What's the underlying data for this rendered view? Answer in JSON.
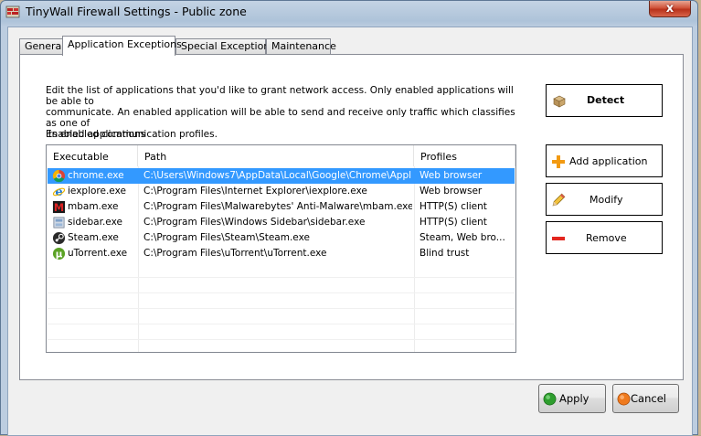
{
  "window": {
    "title": "TinyWall Firewall Settings - Public zone",
    "close_label": "x"
  },
  "tabs": [
    {
      "label": "General"
    },
    {
      "label": "Application Exceptions"
    },
    {
      "label": "Special Exceptions"
    },
    {
      "label": "Maintenance"
    }
  ],
  "panel": {
    "description_line1": "Edit the list of applications that you'd like to grant network access. Only enabled applications will be able to",
    "description_line2": "communicate.  An enabled application will be able to send and receive only traffic which classifies as one of",
    "description_line3": "its enabled communication profiles.",
    "enabled_label": "Enabled applications"
  },
  "table": {
    "columns": [
      "Executable",
      "Path",
      "Profiles"
    ],
    "rows": [
      {
        "exe": "chrome.exe",
        "path": "C:\\Users\\Windows7\\AppData\\Local\\Google\\Chrome\\Appl...",
        "profiles": "Web browser",
        "icon": "chrome-icon"
      },
      {
        "exe": "iexplore.exe",
        "path": "C:\\Program Files\\Internet Explorer\\iexplore.exe",
        "profiles": "Web browser",
        "icon": "internet-explorer-icon"
      },
      {
        "exe": "mbam.exe",
        "path": "C:\\Program Files\\Malwarebytes' Anti-Malware\\mbam.exe",
        "profiles": "HTTP(S) client",
        "icon": "malwarebytes-icon"
      },
      {
        "exe": "sidebar.exe",
        "path": "C:\\Program Files\\Windows Sidebar\\sidebar.exe",
        "profiles": "HTTP(S) client",
        "icon": "sidebar-icon"
      },
      {
        "exe": "Steam.exe",
        "path": "C:\\Program Files\\Steam\\Steam.exe",
        "profiles": "Steam, Web bro...",
        "icon": "steam-icon"
      },
      {
        "exe": "uTorrent.exe",
        "path": "C:\\Program Files\\uTorrent\\uTorrent.exe",
        "profiles": "Blind trust",
        "icon": "utorrent-icon"
      }
    ]
  },
  "buttons": {
    "detect": "Detect",
    "add_application": "Add application",
    "modify": "Modify",
    "remove": "Remove",
    "apply": "Apply",
    "cancel": "Cancel"
  },
  "colors": {
    "selection": "#3399ff",
    "title_close": "#c7402a"
  }
}
